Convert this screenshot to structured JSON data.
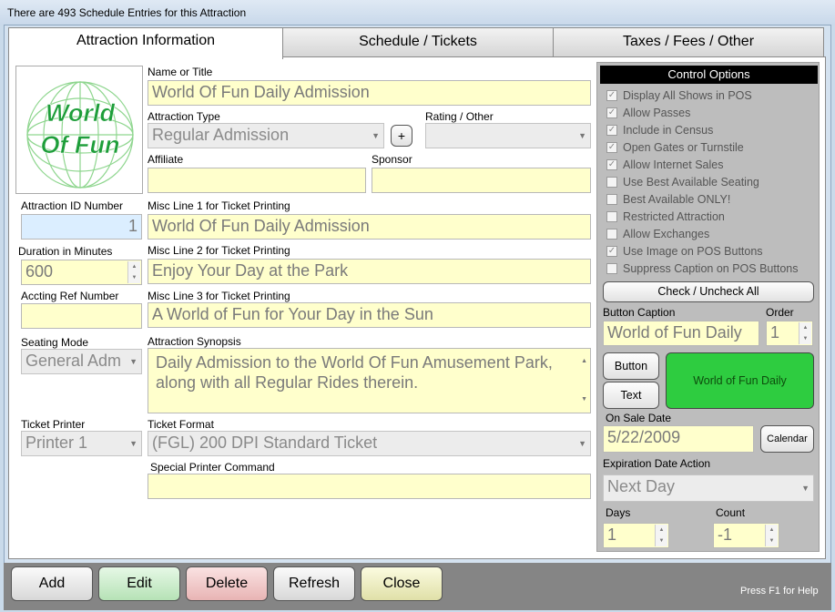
{
  "window": {
    "title": "There are 493 Schedule Entries for this Attraction"
  },
  "tabs": [
    "Attraction Information",
    "Schedule / Tickets",
    "Taxes / Fees / Other"
  ],
  "logo": {
    "line1": "World",
    "line2": "Of Fun"
  },
  "form": {
    "name_label": "Name or Title",
    "name_value": "World Of Fun Daily Admission",
    "type_label": "Attraction Type",
    "type_value": "Regular Admission",
    "plus": "+",
    "rating_label": "Rating / Other",
    "rating_value": "",
    "affiliate_label": "Affiliate",
    "affiliate_value": "",
    "sponsor_label": "Sponsor",
    "sponsor_value": "",
    "id_label": "Attraction ID Number",
    "id_value": "1",
    "misc1_label": "Misc Line 1 for Ticket Printing",
    "misc1_value": "World Of Fun Daily Admission",
    "duration_label": "Duration in Minutes",
    "duration_value": "600",
    "misc2_label": "Misc Line 2 for Ticket Printing",
    "misc2_value": "Enjoy Your Day at the Park",
    "accting_label": "Accting Ref Number",
    "accting_value": "",
    "misc3_label": "Misc Line 3 for Ticket Printing",
    "misc3_value": "A World of Fun for Your Day in the Sun",
    "seating_label": "Seating Mode",
    "seating_value": "General Adm",
    "synopsis_label": "Attraction Synopsis",
    "synopsis_value": "Daily Admission to the World Of Fun Amusement Park, along with all Regular Rides therein.",
    "printer_label": "Ticket Printer",
    "printer_value": "Printer 1",
    "format_label": "Ticket Format",
    "format_value": "(FGL) 200 DPI Standard Ticket",
    "special_label": "Special Printer Command",
    "special_value": ""
  },
  "control": {
    "title": "Control Options",
    "options": [
      {
        "label": "Display All Shows in POS",
        "checked": true
      },
      {
        "label": "Allow Passes",
        "checked": true
      },
      {
        "label": "Include in Census",
        "checked": true
      },
      {
        "label": "Open Gates or Turnstile",
        "checked": true
      },
      {
        "label": "Allow Internet Sales",
        "checked": true
      },
      {
        "label": "Use Best Available Seating",
        "checked": false
      },
      {
        "label": "Best Available ONLY!",
        "checked": false
      },
      {
        "label": "Restricted Attraction",
        "checked": false
      },
      {
        "label": "Allow Exchanges",
        "checked": false
      },
      {
        "label": "Use Image on POS Buttons",
        "checked": true
      },
      {
        "label": "Suppress Caption on POS Buttons",
        "checked": false
      }
    ],
    "check_all": "Check / Uncheck All",
    "caption_label": "Button Caption",
    "caption_value": "World of Fun Daily",
    "order_label": "Order",
    "order_value": "1",
    "button_btn": "Button",
    "text_btn": "Text",
    "preview": "World of Fun Daily",
    "preview_color": "#2ecc40",
    "onsale_label": "On Sale Date",
    "onsale_value": "5/22/2009",
    "calendar": "Calendar",
    "exp_label": "Expiration Date Action",
    "exp_value": "Next Day",
    "days_label": "Days",
    "days_value": "1",
    "count_label": "Count",
    "count_value": "-1"
  },
  "buttons": {
    "add": "Add",
    "edit": "Edit",
    "delete": "Delete",
    "refresh": "Refresh",
    "close": "Close"
  },
  "help": "Press F1 for Help"
}
